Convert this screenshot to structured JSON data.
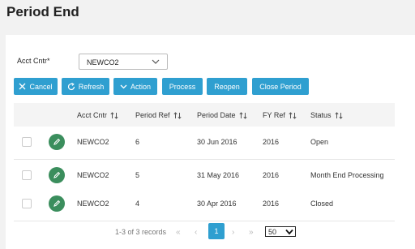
{
  "page": {
    "title": "Period End"
  },
  "filter": {
    "label": "Acct Cntr*",
    "value": "NEWCO2"
  },
  "toolbar": {
    "cancel": "Cancel",
    "refresh": "Refresh",
    "action": "Action",
    "process": "Process",
    "reopen": "Reopen",
    "close_period": "Close Period"
  },
  "table": {
    "headers": [
      "Acct Cntr",
      "Period Ref",
      "Period Date",
      "FY Ref",
      "Status"
    ],
    "rows": [
      {
        "acct_cntr": "NEWCO2",
        "period_ref": "6",
        "period_date": "30 Jun 2016",
        "fy_ref": "2016",
        "status": "Open"
      },
      {
        "acct_cntr": "NEWCO2",
        "period_ref": "5",
        "period_date": "31 May 2016",
        "fy_ref": "2016",
        "status": "Month End Processing"
      },
      {
        "acct_cntr": "NEWCO2",
        "period_ref": "4",
        "period_date": "30 Apr 2016",
        "fy_ref": "2016",
        "status": "Closed"
      }
    ]
  },
  "pagination": {
    "records": "1-3 of 3 records",
    "current_page": "1",
    "page_size": "50"
  },
  "colors": {
    "accent": "#2f9fd0",
    "edit": "#3b8e5d"
  }
}
